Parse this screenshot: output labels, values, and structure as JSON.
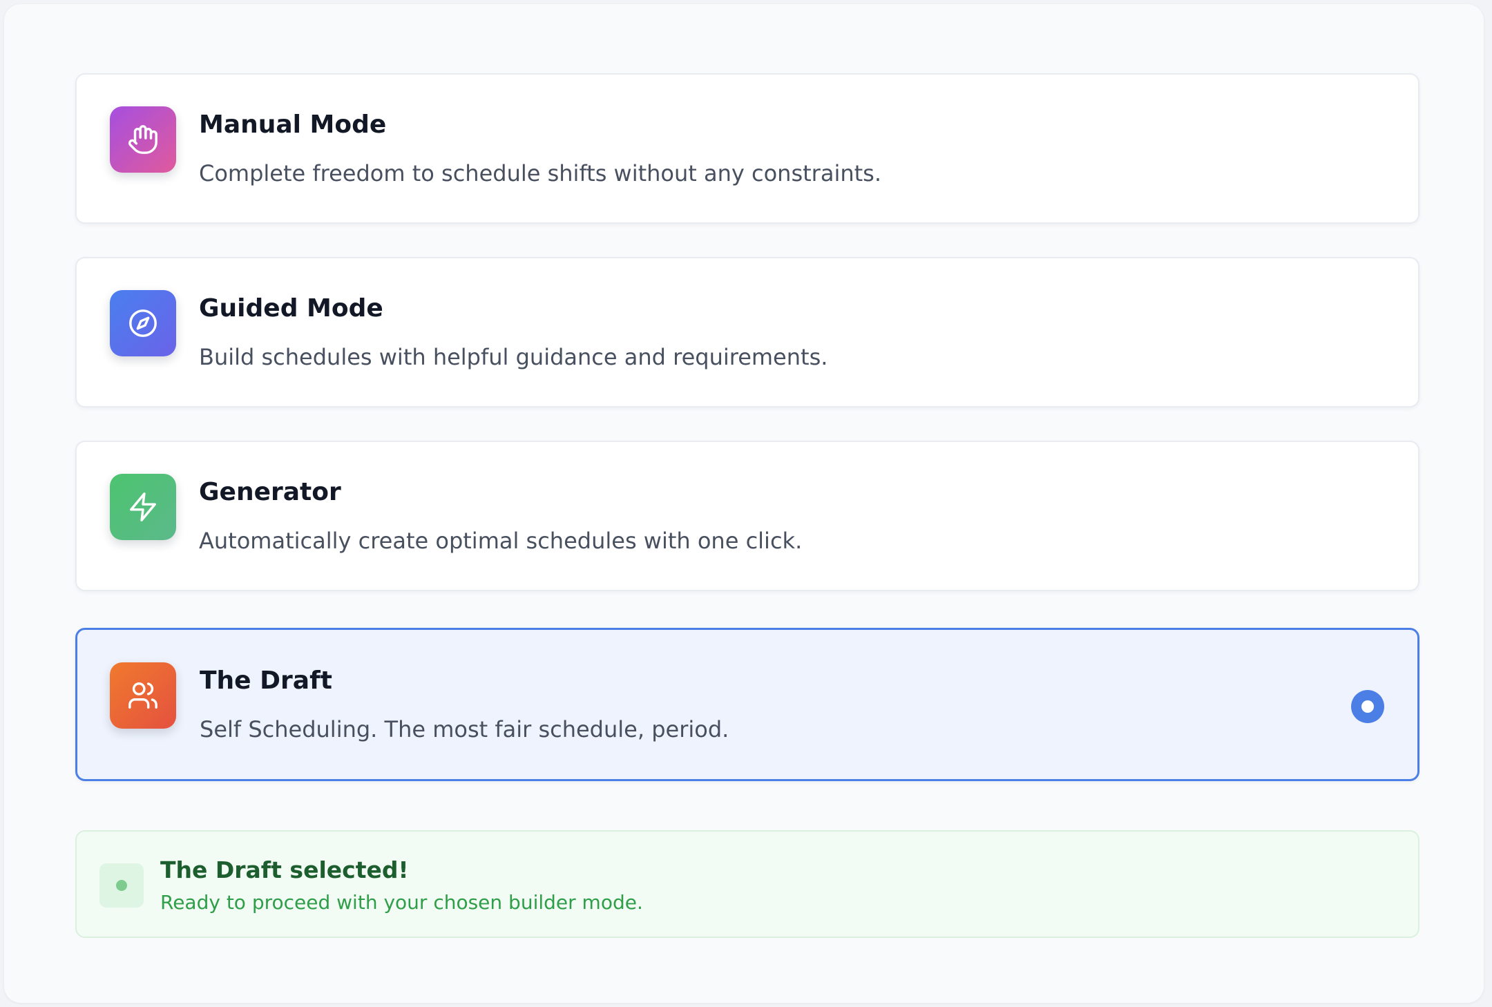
{
  "modes": [
    {
      "id": "manual",
      "title": "Manual Mode",
      "description": "Complete freedom to schedule shifts without any constraints.",
      "icon": "hand-icon",
      "gradient": [
        "#a64fe0",
        "#e05a9c"
      ]
    },
    {
      "id": "guided",
      "title": "Guided Mode",
      "description": "Build schedules with helpful guidance and requirements.",
      "icon": "compass-icon",
      "gradient": [
        "#4a7ff0",
        "#6a63e8"
      ]
    },
    {
      "id": "generator",
      "title": "Generator",
      "description": "Automatically create optimal schedules with one click.",
      "icon": "lightning-icon",
      "gradient": [
        "#4cc46e",
        "#5cb98b"
      ]
    },
    {
      "id": "draft",
      "title": "The Draft",
      "description": "Self Scheduling. The most fair schedule, period.",
      "icon": "users-icon",
      "gradient": [
        "#f07a2e",
        "#e4513f"
      ],
      "selected": true
    }
  ],
  "notice": {
    "title": "The Draft selected!",
    "text": "Ready to proceed with your chosen builder mode."
  },
  "colors": {
    "accent": "#4b7fe6",
    "success_bg": "#f2fcf4",
    "success_title": "#1d5e2e",
    "success_text": "#2f9e48"
  }
}
